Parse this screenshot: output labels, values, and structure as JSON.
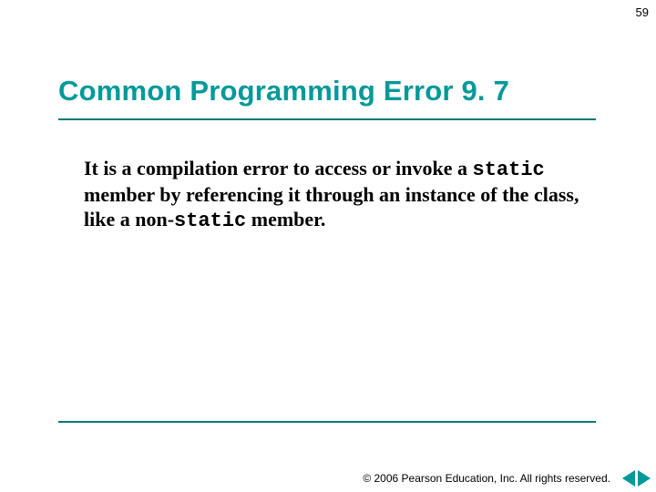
{
  "page_number": "59",
  "heading": "Common Programming Error 9. 7",
  "body": {
    "t1": "It is a compilation error to access or invoke a ",
    "c1": "static",
    "t2": " member by referencing it through an instance of the class, like a non-",
    "c2": "static",
    "t3": " member."
  },
  "footer": "© 2006 Pearson Education, Inc.  All rights reserved.",
  "colors": {
    "accent": "#009999"
  }
}
